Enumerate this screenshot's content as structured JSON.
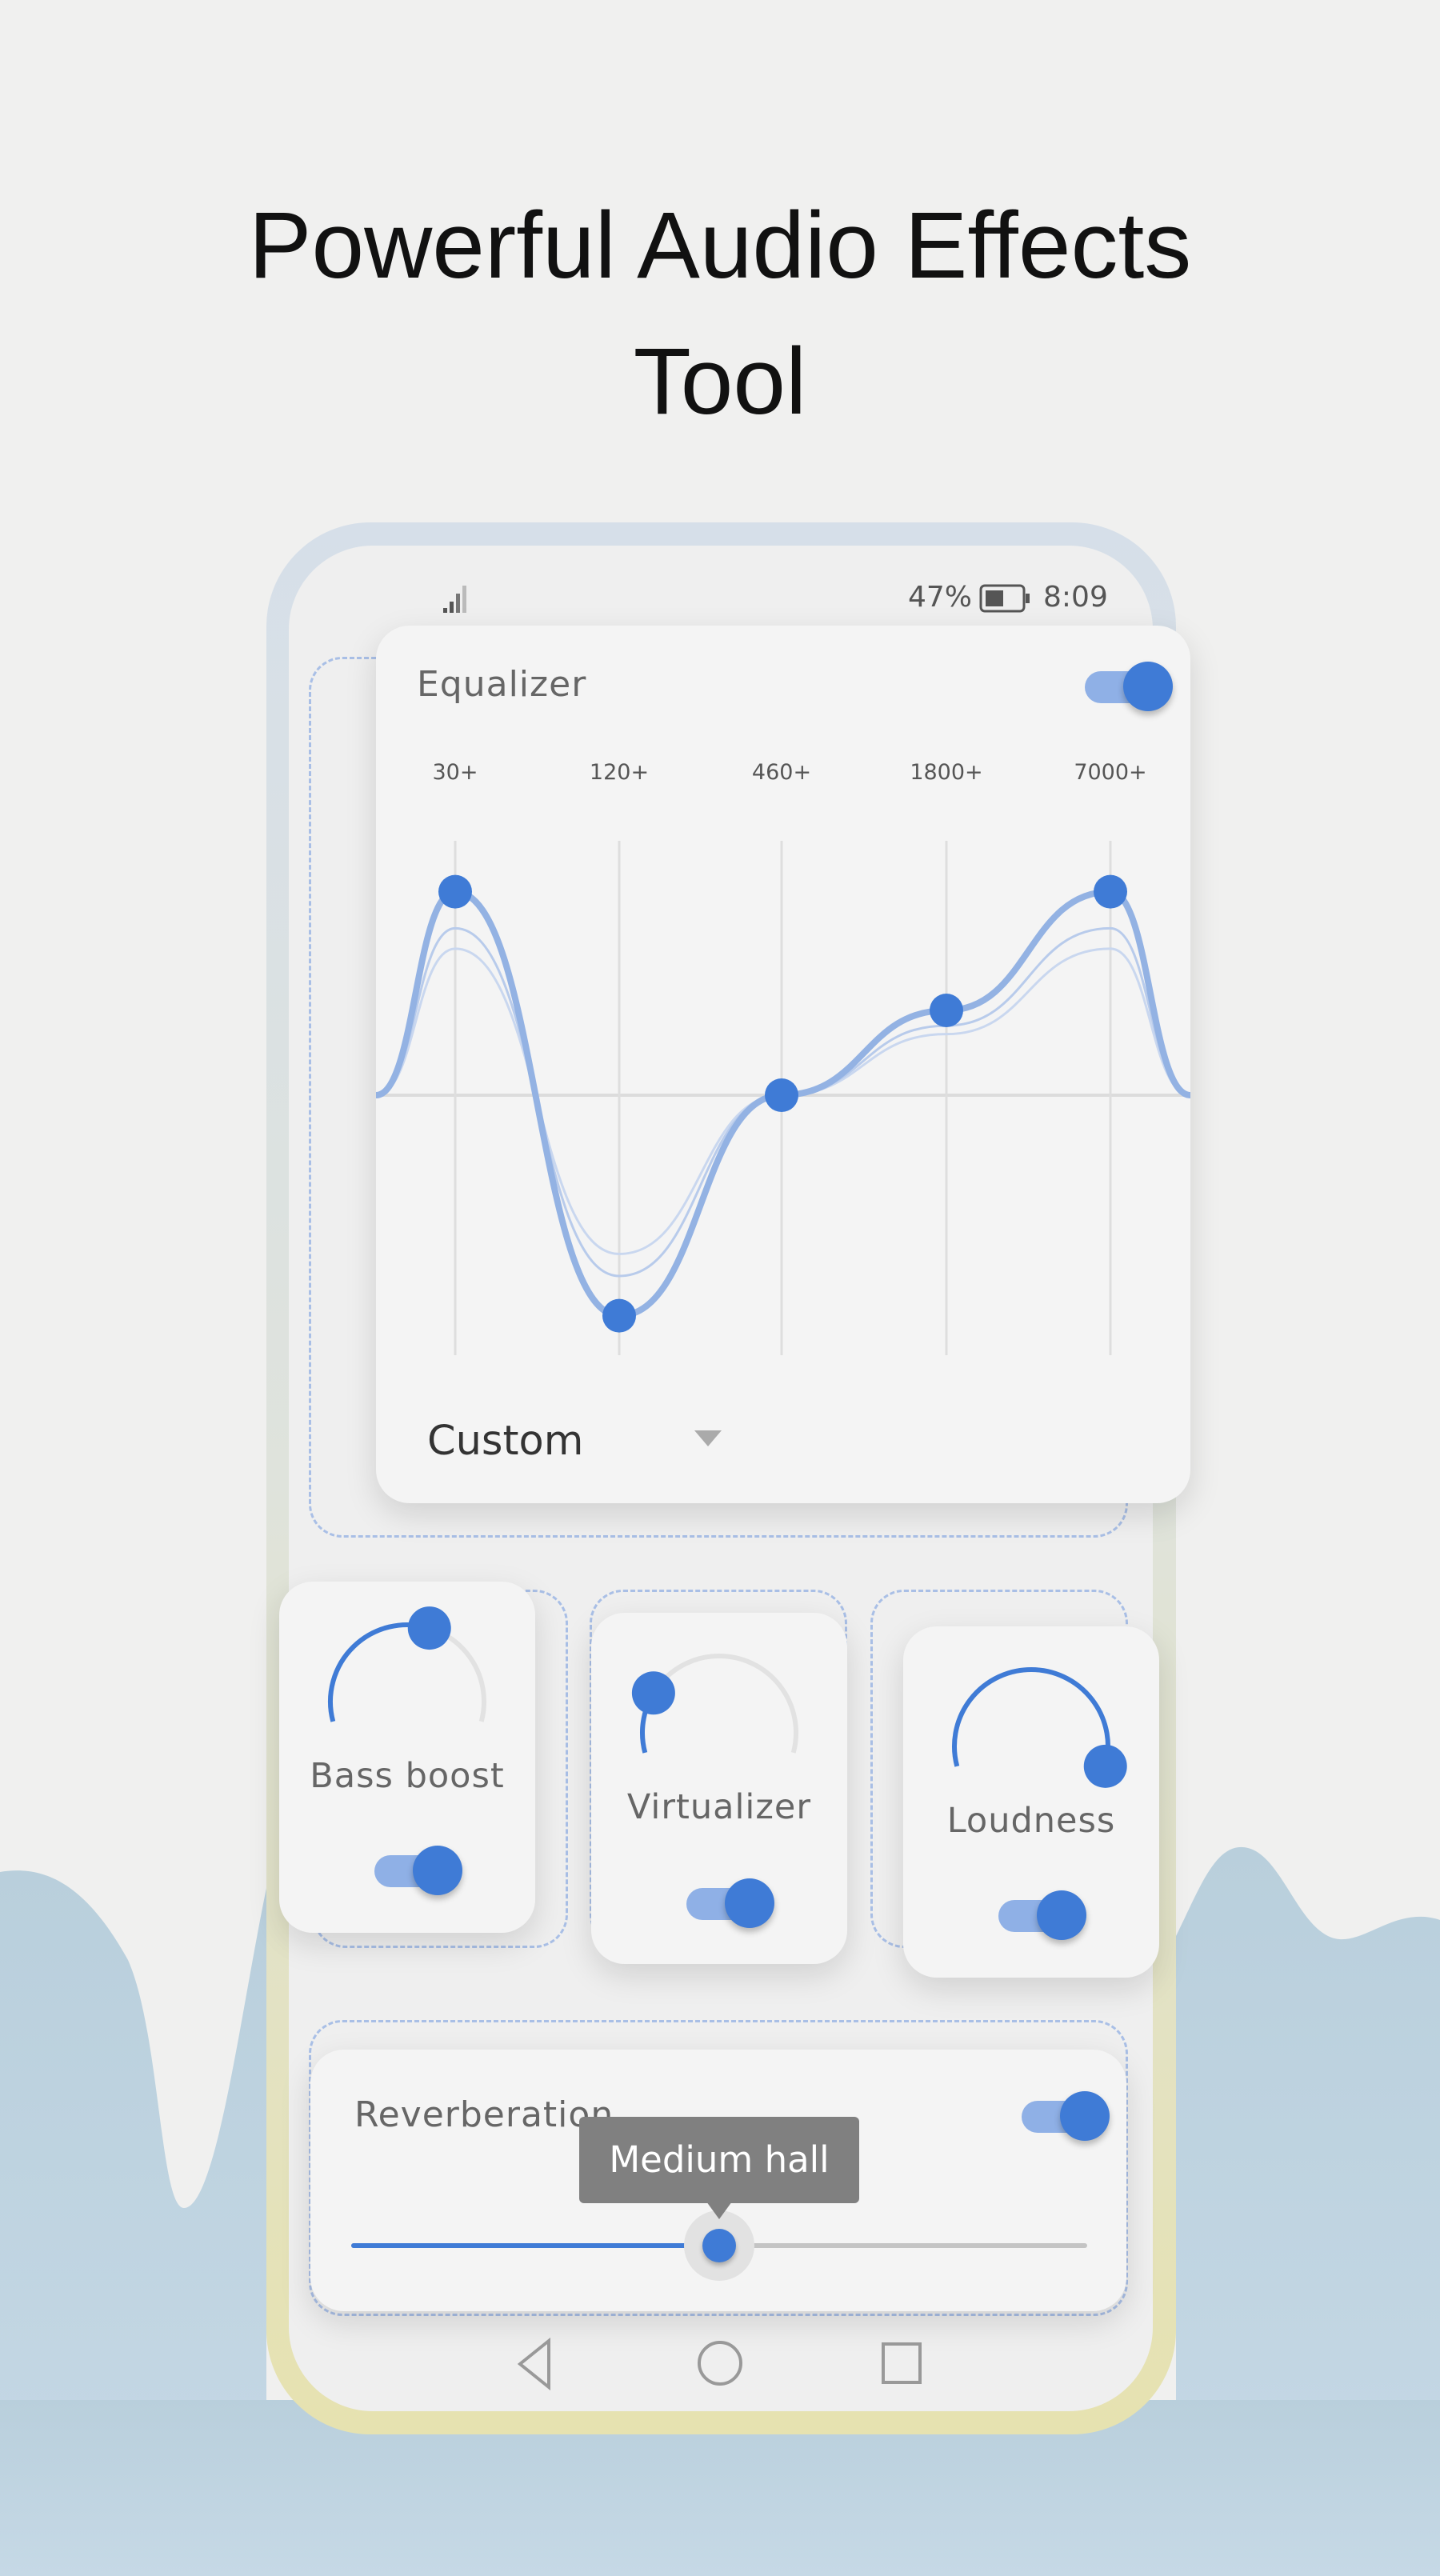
{
  "headline": {
    "line1": "Powerful Audio Effects",
    "line2": "Tool"
  },
  "status_bar": {
    "battery": "47%",
    "time": "8:09",
    "icons": [
      "signal-icon",
      "battery-icon"
    ]
  },
  "colors": {
    "accent": "#3f7bd6",
    "accent_light": "#8fb0e6",
    "tooltip": "#808080"
  },
  "equalizer": {
    "title": "Equalizer",
    "enabled": true,
    "bands": [
      {
        "label": "30+",
        "gain": 12
      },
      {
        "label": "120+",
        "gain": -13
      },
      {
        "label": "460+",
        "gain": 0
      },
      {
        "label": "1800+",
        "gain": 5
      },
      {
        "label": "7000+",
        "gain": 12
      }
    ],
    "gain_range": [
      -15,
      15
    ],
    "preset": "Custom"
  },
  "effects": [
    {
      "label": "Bass boost",
      "level": 0.58,
      "enabled": true
    },
    {
      "label": "Virtualizer",
      "level": 0.22,
      "enabled": true
    },
    {
      "label": "Loudness",
      "level": 1.0,
      "enabled": true
    }
  ],
  "reverberation": {
    "title": "Reverberation",
    "enabled": true,
    "value_label": "Medium hall",
    "position": 0.5
  },
  "nav": {
    "icons": [
      "back-icon",
      "home-icon",
      "recents-icon"
    ]
  }
}
